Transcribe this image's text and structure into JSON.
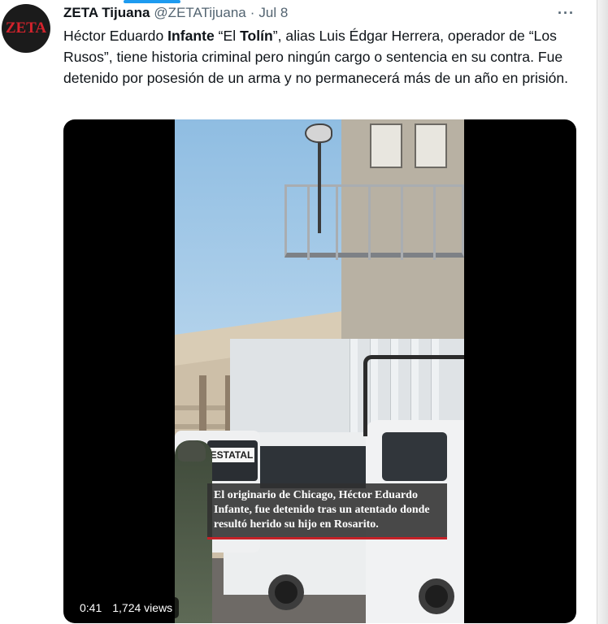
{
  "tweet": {
    "author_name": "ZETA Tijuana",
    "handle": "@ZETATijuana",
    "separator": "·",
    "date": "Jul 8",
    "more_icon": "···",
    "avatar_text": "ZETA",
    "text": {
      "p1": "Héctor Eduardo ",
      "b1": "Infante",
      "p2": " “El ",
      "b2": "Tolín",
      "p3": "”, alias Luis Édgar Herrera, operador de “Los Rusos”, tiene historia criminal pero ningún cargo o sentencia en su contra. Fue detenido por posesión de un arma y no permanecerá más de un año en prisión."
    }
  },
  "media": {
    "van_label": "ESTATAL",
    "caption": "El originario de Chicago, Héctor Eduardo Infante, fue detenido tras un atentado donde resultó herido su hijo en Rosarito.",
    "duration": "0:41",
    "views": "1,724 views"
  },
  "colors": {
    "accent": "#1d9bf0",
    "text": "#0f1419",
    "secondary": "#536471",
    "caption_stripe": "#c52128",
    "logo_red": "#d3232c"
  }
}
